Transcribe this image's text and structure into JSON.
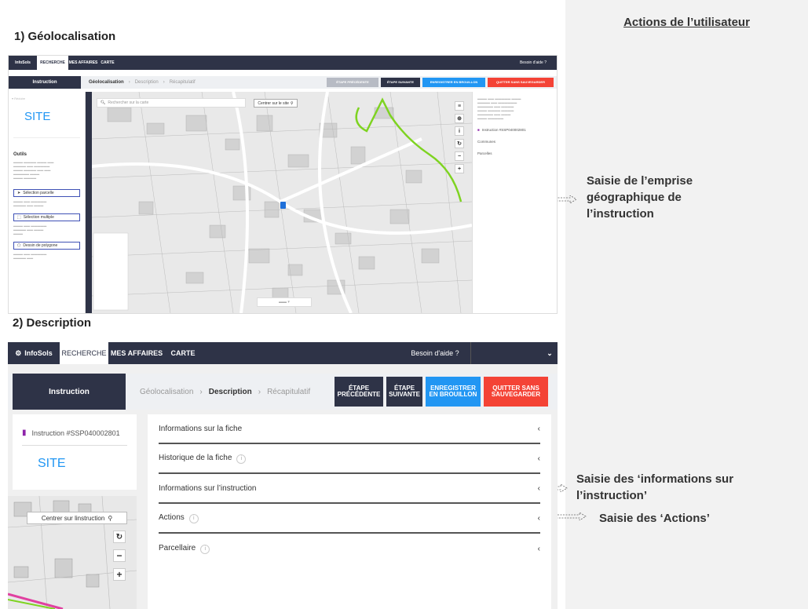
{
  "right_panel": {
    "title": "Actions de l’utilisateur",
    "annotation_1": [
      "Saisie de l’emprise",
      "géographique de",
      "l’instruction"
    ],
    "annotation_2": [
      "Saisie des ‘informations sur",
      "l’instruction’"
    ],
    "annotation_3": "Saisie des ‘Actions’"
  },
  "section1": {
    "heading": "1) Géolocalisation",
    "nav": {
      "logo": "InfoSols",
      "tabs": [
        "RECHERCHE",
        "MES AFFAIRES",
        "CARTE"
      ],
      "help": "Besoin d'aide ?"
    },
    "stepbar": {
      "instruction": "Instruction",
      "steps": [
        "Géolocalisation",
        "Description",
        "Récapitulatif"
      ],
      "buttons": [
        "ÉTAPE PRÉCÉDENTE",
        "ÉTAPE SUIVANTE",
        "ENREGISTRER EN BROUILLON",
        "QUITTER SANS SAUVEGARDER"
      ]
    },
    "sidebar": {
      "site_label": "SITE",
      "outils": "Outils",
      "tools": [
        "Sélection parcelle",
        "Sélection multiple",
        "Dessin de polygone"
      ]
    },
    "map": {
      "search_placeholder": "Rechercher sur la carte",
      "center_button": "Centrer sur le site"
    },
    "right": {
      "instruction": "Instruction #SSP040002801",
      "communes": "Communes",
      "parcelles": "Parcelles"
    }
  },
  "section2": {
    "heading": "2) Description",
    "nav": {
      "logo": "InfoSols",
      "tabs": [
        "RECHERCHE",
        "MES AFFAIRES",
        "CARTE"
      ],
      "help": "Besoin d'aide ?"
    },
    "stepbar": {
      "instruction": "Instruction",
      "step1": "Géolocalisation",
      "step2": "Description",
      "step3": "Récapitulatif",
      "buttons": [
        {
          "label": "ÉTAPE PRÉCÉDENTE",
          "color": "#2e3347"
        },
        {
          "label": "ÉTAPE SUIVANTE",
          "color": "#2e3347"
        },
        {
          "label": "ENREGISTRER EN BROUILLON",
          "color": "#2196f3"
        },
        {
          "label": "QUITTER SANS SAUVEGARDER",
          "color": "#f44336"
        }
      ]
    },
    "card": {
      "instruction": "Instruction #SSP040002801",
      "site": "SITE"
    },
    "map": {
      "center_button": "Centrer sur linstruction"
    },
    "accordion": [
      {
        "label": "Informations sur la fiche",
        "badge": false
      },
      {
        "label": "Historique de la fiche",
        "badge": true
      },
      {
        "label": "Informations sur l’instruction",
        "badge": false
      },
      {
        "label": "Actions",
        "badge": true
      },
      {
        "label": "Parcellaire",
        "badge": true
      }
    ]
  }
}
